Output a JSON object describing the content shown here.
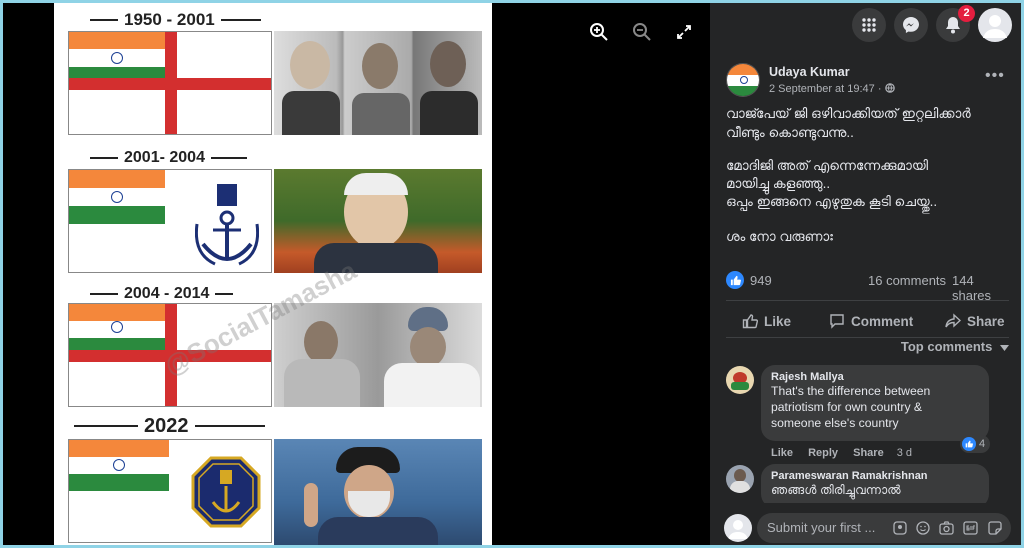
{
  "image": {
    "sections": [
      {
        "title": "1950 - 2001"
      },
      {
        "title": "2001- 2004"
      },
      {
        "title": "2004 - 2014"
      },
      {
        "title": "2022"
      }
    ],
    "watermark": "@SocialTamasha"
  },
  "viewer": {
    "zoom_in_icon": "zoom-in-icon",
    "zoom_out_icon": "zoom-out-icon",
    "fullscreen_icon": "fullscreen-icon"
  },
  "topbar": {
    "notification_count": "2"
  },
  "post": {
    "author": "Udaya Kumar",
    "timestamp": "2 September at 19:47 · ",
    "lines": [
      "വാജ്പേയ് ജി ഒഴിവാക്കിയത് ഇറ്റലിക്കാർ",
      "വീണ്ടും കൊണ്ടുവന്നു..",
      "",
      "മോദിജി അത് എന്നെന്നേക്കുമായി",
      "മായിച്ചു കളഞ്ഞു..",
      "ഒപ്പം ഇങ്ങനെ എഴുതുക കൂടി ചെയ്തു..",
      "",
      "ശം നോ വരുണാഃ"
    ],
    "reactions": "949",
    "comments": "16 comments",
    "shares": "144 shares",
    "actions": {
      "like": "Like",
      "comment": "Comment",
      "share": "Share"
    },
    "top_comments": "Top comments"
  },
  "comments": [
    {
      "name": "Rajesh Mallya",
      "lines": [
        "That's the difference between",
        "patriotism for own country &",
        "someone else's country"
      ],
      "like": "Like",
      "reply": "Reply",
      "share": "Share",
      "time": "3 d",
      "likes": "4"
    },
    {
      "name": "Parameswaran Ramakrishnan",
      "lines": [
        "ഞങ്ങൾ തിരിച്ചുവന്നാൽ"
      ]
    }
  ],
  "composer": {
    "placeholder": "Submit your first ..."
  },
  "colors": {
    "panel": "#242526",
    "accent": "#2d88ff",
    "badge": "#e41e3f"
  }
}
